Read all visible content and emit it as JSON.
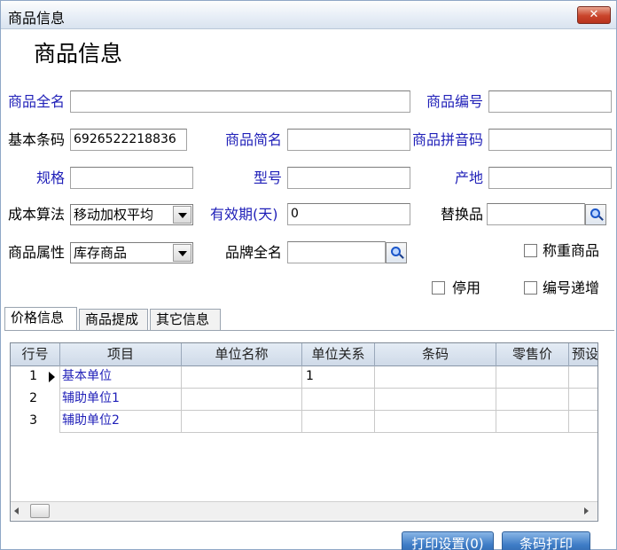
{
  "window": {
    "title": "商品信息",
    "close_label": "✕"
  },
  "heading": "商品信息",
  "fields": {
    "full_name": {
      "label": "商品全名",
      "value": ""
    },
    "code": {
      "label": "商品编号",
      "value": ""
    },
    "barcode": {
      "label": "基本条码",
      "value": "6926522218836"
    },
    "short_name": {
      "label": "商品简名",
      "value": ""
    },
    "pinyin": {
      "label": "商品拼音码",
      "value": ""
    },
    "spec": {
      "label": "规格",
      "value": ""
    },
    "model": {
      "label": "型号",
      "value": ""
    },
    "origin": {
      "label": "产地",
      "value": ""
    },
    "cost_method": {
      "label": "成本算法",
      "value": "移动加权平均"
    },
    "shelf_life": {
      "label": "有效期(天)",
      "value": "0"
    },
    "substitute": {
      "label": "替换品",
      "value": ""
    },
    "attribute": {
      "label": "商品属性",
      "value": "库存商品"
    },
    "brand": {
      "label": "品牌全名",
      "value": ""
    }
  },
  "checkboxes": {
    "weighed": {
      "label": "称重商品",
      "checked": false
    },
    "disabled": {
      "label": "停用",
      "checked": false
    },
    "auto_increment": {
      "label": "编号递增",
      "checked": false
    }
  },
  "tabs": [
    "价格信息",
    "商品提成",
    "其它信息"
  ],
  "grid": {
    "columns": [
      "行号",
      "项目",
      "单位名称",
      "单位关系",
      "条码",
      "零售价",
      "预设"
    ],
    "rows": [
      {
        "no": "1",
        "item": "基本单位",
        "unit_name": "",
        "relation": "1",
        "barcode": "",
        "retail": "",
        "preset": ""
      },
      {
        "no": "2",
        "item": "辅助单位1",
        "unit_name": "",
        "relation": "",
        "barcode": "",
        "retail": "",
        "preset": ""
      },
      {
        "no": "3",
        "item": "辅助单位2",
        "unit_name": "",
        "relation": "",
        "barcode": "",
        "retail": "",
        "preset": ""
      }
    ]
  },
  "buttons": {
    "print_settings": "打印设置(0)",
    "barcode_print": "条码打印"
  },
  "colors": {
    "label_blue": "#1f1fb8",
    "button_blue": "#3e7cc6"
  }
}
